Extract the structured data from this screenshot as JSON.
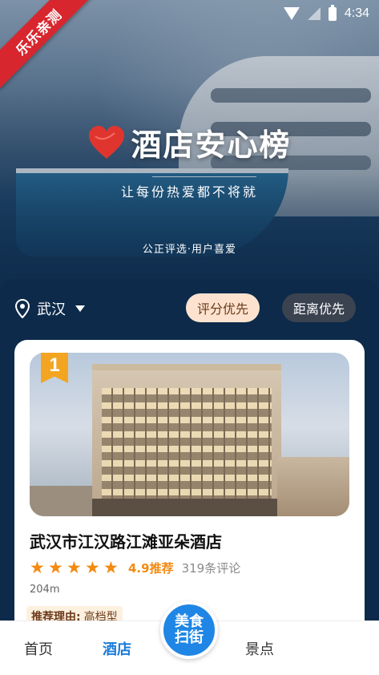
{
  "status_bar": {
    "time": "4:34"
  },
  "ribbon": {
    "text": "乐乐亲测"
  },
  "hero": {
    "title": "酒店安心榜",
    "subtitle": "让每份热爱都不将就",
    "tagline": "公正评选·用户喜爱"
  },
  "location": {
    "city": "武汉"
  },
  "sort": {
    "score_label": "评分优先",
    "distance_label": "距离优先",
    "active": "score"
  },
  "hotel": {
    "rank": "1",
    "name": "武汉市江汉路江滩亚朵酒店",
    "stars": 5,
    "score": "4.9推荐",
    "reviews": "319条评论",
    "distance": "204m",
    "reason_label": "推荐理由:",
    "reason_value": "高档型"
  },
  "tabs": {
    "home": "首页",
    "hotel": "酒店",
    "center_top": "美食",
    "center_bottom": "扫街",
    "spot": "景点"
  },
  "colors": {
    "accent_blue": "#1f86e5",
    "star_orange": "#f38a12",
    "badge_gold": "#f3a521"
  }
}
